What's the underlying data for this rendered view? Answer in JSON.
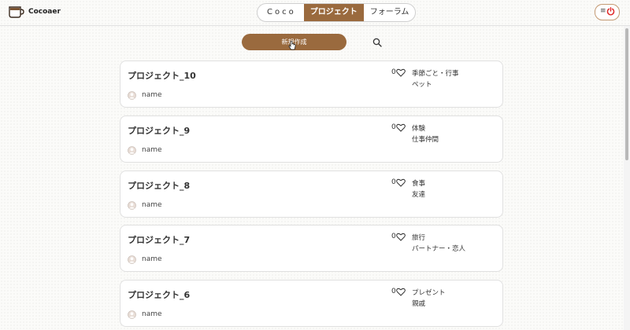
{
  "header": {
    "brand": "Cocoaer",
    "nav": [
      {
        "label": "Coco"
      },
      {
        "label": "プロジェクト",
        "active": true
      },
      {
        "label": "フォーラム"
      }
    ],
    "menu_icon": "hamburger-icon",
    "power_icon": "power-icon",
    "accent_color": "#9a6a3e"
  },
  "toolbar": {
    "new_label": "新規作成",
    "search_icon": "search-icon"
  },
  "projects": [
    {
      "title": "プロジェクト_10",
      "author": "name",
      "likes": "0",
      "tags": [
        "季節ごと・行事",
        "ペット"
      ]
    },
    {
      "title": "プロジェクト_9",
      "author": "name",
      "likes": "0",
      "tags": [
        "体験",
        "仕事仲間"
      ]
    },
    {
      "title": "プロジェクト_8",
      "author": "name",
      "likes": "0",
      "tags": [
        "食事",
        "友達"
      ]
    },
    {
      "title": "プロジェクト_7",
      "author": "name",
      "likes": "0",
      "tags": [
        "旅行",
        "パートナー・恋人"
      ]
    },
    {
      "title": "プロジェクト_6",
      "author": "name",
      "likes": "0",
      "tags": [
        "プレゼント",
        "親戚"
      ]
    }
  ]
}
